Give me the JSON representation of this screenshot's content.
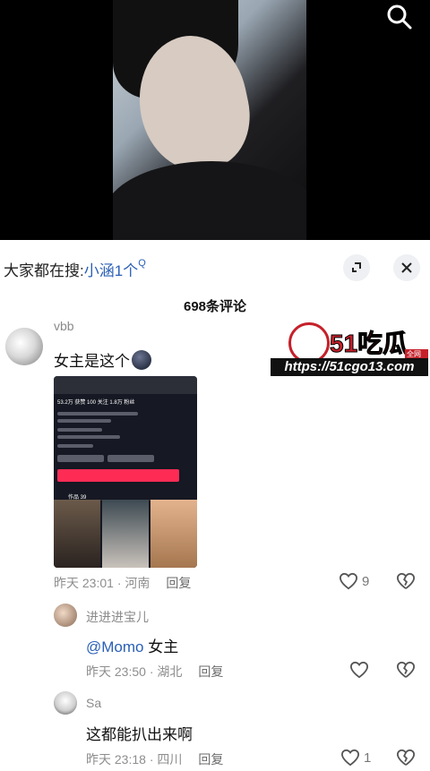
{
  "search_bar": {
    "prefix": "大家都在搜:",
    "keyword": "小涵1个",
    "superscript": "Q"
  },
  "comments_header": {
    "count_label": "698条评论"
  },
  "watermark": {
    "brand_cn": "51吃瓜",
    "tag": "全网首发",
    "url": "https://51cgo13.com"
  },
  "comments": [
    {
      "username": "vbb",
      "text": "女主是这个",
      "time": "昨天 23:01",
      "location": "河南",
      "reply_label": "回复",
      "likes": "9",
      "screenshot": {
        "stats": "53.2万 获赞  100 关注  1.8万 粉丝",
        "tab_label": "作品 39"
      }
    },
    {
      "username": "进进进宝儿",
      "text": "@Momo 女主",
      "mention": "@Momo",
      "time": "昨天 23:50",
      "location": "湖北",
      "reply_label": "回复",
      "likes": ""
    },
    {
      "username": "Sa",
      "text": "这都能扒出来啊",
      "time": "昨天 23:18",
      "location": "四川",
      "reply_label": "回复",
      "likes": "1"
    }
  ],
  "colors": {
    "accent_link": "#2a5fb6",
    "brand_red": "#c5212b",
    "douyin_red": "#fe2c55"
  }
}
